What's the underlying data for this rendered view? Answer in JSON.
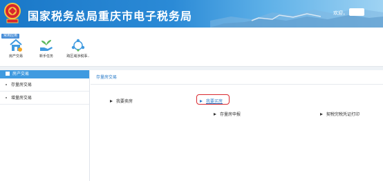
{
  "header": {
    "title": "国家税务总局重庆市电子税务局",
    "welcome": "欢迎，",
    "emblem_icon": "tax-emblem-icon",
    "colors": {
      "banner_start": "#1a78c8",
      "banner_end": "#9fd3f3"
    }
  },
  "toolbar": {
    "tag": "常用应用",
    "items": [
      {
        "label": "房产交易",
        "icon": "house-icon"
      },
      {
        "label": "新手任务",
        "icon": "hand-plant-icon"
      },
      {
        "label": "跨区域涉税事..",
        "icon": "network-nodes-icon"
      }
    ]
  },
  "sidebar": {
    "header": "房产交易",
    "items": [
      {
        "label": "存量房交易"
      },
      {
        "label": "增量房交易"
      }
    ]
  },
  "main": {
    "title": "存量房交易",
    "links": {
      "sell": "我要卖房",
      "buy": "我要买房",
      "declare": "存量房申报",
      "print": "契税完税凭证打印"
    },
    "accent": "#2b7cc9",
    "highlight_color": "#d9262c"
  }
}
